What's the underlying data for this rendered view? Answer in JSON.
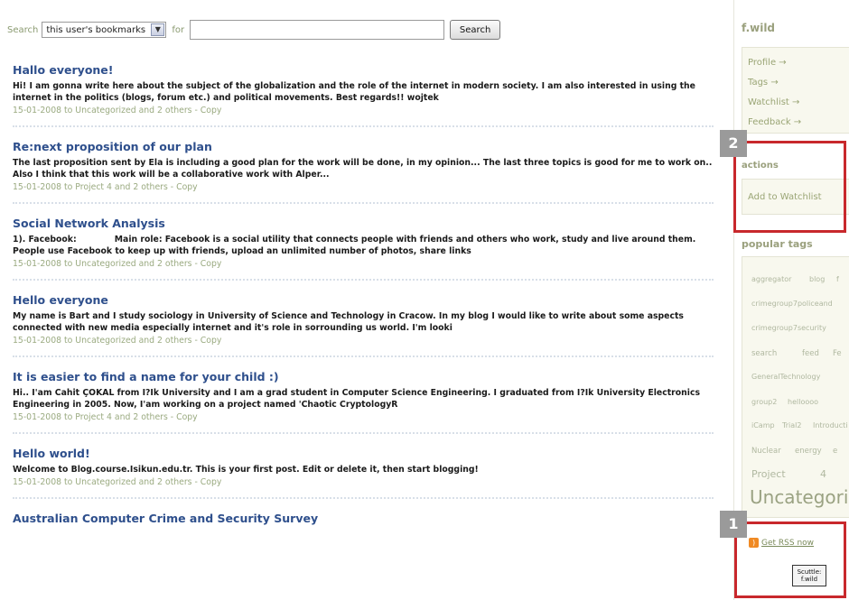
{
  "search": {
    "label": "Search",
    "scope_selected": "this user's bookmarks",
    "for_label": "for",
    "input_value": "",
    "button_label": "Search"
  },
  "posts": [
    {
      "title": "Hallo everyone!",
      "body": "Hi! I am gonna write here about the subject of the globalization and the role of the internet in modern society. I am also interested in using the internet in the politics (blogs, forum etc.) and political movements. Best regards!! wojtek",
      "meta": "15-01-2008 to Uncategorized and 2 others - Copy"
    },
    {
      "title": "Re:next proposition of our plan",
      "body": "The last proposition sent by Ela is including a good plan for the work will be done, in my opinion... The last three topics is good for me to work on.. Also I think that this work will be a collaborative work with Alper...",
      "meta": "15-01-2008 to Project 4 and 2 others - Copy"
    },
    {
      "title": "Social Network Analysis",
      "body": "1). Facebook:             Main role: Facebook is a social utility that connects people with friends and others who work, study and live around them. People use Facebook to keep up with friends, upload an unlimited number of photos, share links",
      "meta": "15-01-2008 to Uncategorized and 2 others - Copy"
    },
    {
      "title": "Hello everyone",
      "body": "My name is Bart and  I study sociology  in University of Science and Technology in Cracow. In my blog I would like to  write about some aspects connected with new media especially internet and it's role in sorrounding us world. I'm looki",
      "meta": "15-01-2008 to Uncategorized and 2 others - Copy"
    },
    {
      "title": "It is easier to find a name for your child :)",
      "body": "Hi.. I'am Cahit ÇOKAL from I?Ik University and I am a grad student in Computer Science Engineering. I graduated from I?Ik University Electronics Engineering in 2005. Now, I'am working on a project named 'Chaotic CryptologyR",
      "meta": "15-01-2008 to Project 4 and 2 others - Copy"
    },
    {
      "title": "Hello world!",
      "body": "Welcome to Blog.course.Isikun.edu.tr. This is your first post. Edit or delete it, then start blogging!",
      "meta": "15-01-2008 to Uncategorized and 2 others - Copy"
    },
    {
      "title": "Australian Computer Crime and Security Survey",
      "body": "",
      "meta": ""
    }
  ],
  "sidebar": {
    "username": "f.wild",
    "links": [
      "Profile →",
      "Tags →",
      "Watchlist →",
      "Feedback →"
    ],
    "actions_heading": "actions",
    "add_watchlist": "Add to Watchlist",
    "popular_tags_heading": "popular tags",
    "tags": [
      {
        "text": "aggregator"
      },
      {
        "text": "blog"
      },
      {
        "text": "f"
      },
      {
        "text": "crimegroup7policeand"
      },
      {
        "text": "crimegroup7security"
      },
      {
        "text": "search"
      },
      {
        "text": "feed"
      },
      {
        "text": "Fe"
      },
      {
        "text": "GeneralTechnology"
      },
      {
        "text": "group2"
      },
      {
        "text": "helloooo"
      },
      {
        "text": "iCamp"
      },
      {
        "text": "Trial2"
      },
      {
        "text": "Introducti"
      },
      {
        "text": "Nuclear"
      },
      {
        "text": "energy"
      },
      {
        "text": "e"
      },
      {
        "text": "Project"
      },
      {
        "text": "4"
      },
      {
        "text": "Uncategori"
      }
    ],
    "rss_label": "Get RSS now",
    "scuttle_badge": "Scuttle: f.wild"
  },
  "callouts": {
    "one": "1",
    "two": "2"
  },
  "colors": {
    "post_title": "#2e4f8c",
    "meta_text": "#9aaa80",
    "callout_red": "#c8282c",
    "badge_gray": "#9a9a9a"
  }
}
